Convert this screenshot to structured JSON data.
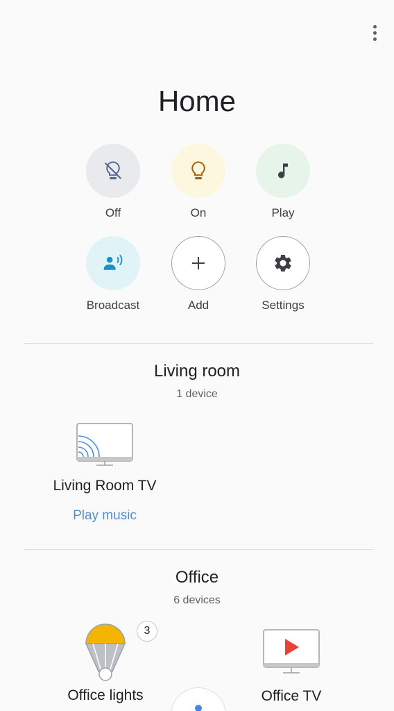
{
  "header": {
    "title": "Home",
    "menu_icon": "more-vert-icon"
  },
  "actions": [
    {
      "label": "Off",
      "icon": "lights-off-icon",
      "bg": "#e8eaed"
    },
    {
      "label": "On",
      "icon": "lightbulb-icon",
      "bg": "#fef7e0"
    },
    {
      "label": "Play",
      "icon": "music-note-icon",
      "bg": "#e6f4ea"
    },
    {
      "label": "Broadcast",
      "icon": "broadcast-icon",
      "bg": "#e0f4f8"
    },
    {
      "label": "Add",
      "icon": "add-icon",
      "bg": "#ffffff"
    },
    {
      "label": "Settings",
      "icon": "gear-icon",
      "bg": "#ffffff"
    }
  ],
  "rooms": [
    {
      "name": "Living room",
      "count": "1 device",
      "devices": [
        {
          "name": "Living Room TV",
          "icon": "cast-tv-icon",
          "action": "Play music"
        }
      ]
    },
    {
      "name": "Office",
      "count": "6 devices",
      "devices": [
        {
          "name": "Office lights",
          "icon": "light-group-icon",
          "badge": "3"
        },
        {
          "name": "Office TV",
          "icon": "tv-play-icon"
        }
      ]
    }
  ],
  "colors": {
    "accent_blue": "#4a90e2",
    "lamp_yellow": "#f4b400",
    "play_red": "#ea4335",
    "assistant_blue": "#4285f4"
  }
}
